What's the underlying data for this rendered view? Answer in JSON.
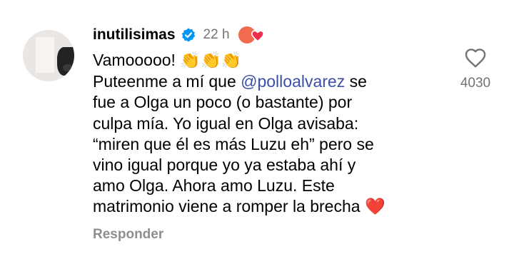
{
  "comment": {
    "username": "inutilisimas",
    "timestamp": "22 h",
    "lines": [
      {
        "text": "Vamooooo! ",
        "emoji": "👏👏👏"
      },
      {
        "before": "Puteenme a mí que ",
        "mention": "@polloalvarez",
        "after": " se"
      },
      {
        "text": "fue a Olga un poco (o bastante) por"
      },
      {
        "text": "culpa mía. Yo igual en Olga avisaba:"
      },
      {
        "text": "“miren que él es más Luzu eh” pero se"
      },
      {
        "text": "vino igual porque yo ya estaba ahí y"
      },
      {
        "text": "amo Olga. Ahora amo Luzu. Este"
      },
      {
        "text": "matrimonio viene a romper la brecha ",
        "emoji": "❤️"
      }
    ],
    "reply_label": "Responder",
    "like_count": "4030"
  },
  "icons": {
    "verified": "verified-badge-icon",
    "liked_by_author": "creator-liked-heart-icon",
    "like": "heart-outline-icon"
  },
  "colors": {
    "mention": "#3a4fa8",
    "verified": "#0095f6",
    "secondary_text": "#737373",
    "heart": "#e0262f"
  }
}
